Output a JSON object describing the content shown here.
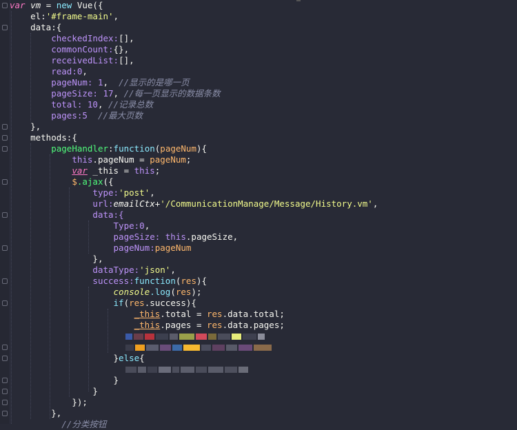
{
  "code": {
    "l1_var": "var",
    "l1_vm": "vm",
    "l1_eq": " = ",
    "l1_new": "new",
    "l1_vue": " Vue({",
    "l2_el": "el:",
    "l2_val": "'#frame-main'",
    "l2_end": ",",
    "l3_data": "data:{",
    "l4_key": "checkedIndex:",
    "l4_val": "[],",
    "l5_key": "commonCount:",
    "l5_val": "{},",
    "l6_key": "receivedList:",
    "l6_val": "[],",
    "l7_key": "read:",
    "l7_num": "0",
    "l7_end": ",",
    "l8_key": "pageNum: ",
    "l8_num": "1",
    "l8_end": ",  ",
    "l8_com": "//显示的是哪一页",
    "l9_key": "pageSize: ",
    "l9_num": "17",
    "l9_end": ", ",
    "l9_com": "//每一页显示的数据条数",
    "l10_key": "total: ",
    "l10_num": "10",
    "l10_end": ", ",
    "l10_com": "//记录总数",
    "l11_key": "pages:",
    "l11_num": "5",
    "l11_sp": "  ",
    "l11_com": "//最大页数",
    "l12": "},",
    "l13": "methods:{",
    "l14_fn": "pageHandler",
    "l14_colon": ":",
    "l14_function": "function",
    "l14_p1": "(",
    "l14_arg": "pageNum",
    "l14_p2": "){",
    "l15_this": "this",
    "l15_prop": ".pageNum",
    "l15_eq": " = ",
    "l15_val": "pageNum",
    "l15_end": ";",
    "l16_var": "var",
    "l16_name": " _this",
    "l16_eq": " = ",
    "l16_this": "this",
    "l16_end": ";",
    "l17_a": "$",
    "l17_b": ".ajax",
    "l17_c": "({",
    "l18_key": "type:",
    "l18_val": "'post'",
    "l18_end": ",",
    "l19_key": "url:",
    "l19_var": "emailCtx",
    "l19_plus": "+",
    "l19_val": "'/CommunicationManage/Message/History.vm'",
    "l19_end": ",",
    "l20": "data:{",
    "l21_key": "Type:",
    "l21_num": "0",
    "l21_end": ",",
    "l22_key": "pageSize: ",
    "l22_this": "this",
    "l22_prop": ".pageSize",
    "l22_end": ",",
    "l23_key": "pageNum:",
    "l23_val": "pageNum",
    "l24": "},",
    "l25_key": "dataType:",
    "l25_val": "'json'",
    "l25_end": ",",
    "l26_key": "success:",
    "l26_function": "function",
    "l26_p1": "(",
    "l26_arg": "res",
    "l26_p2": "){",
    "l27_console": "console",
    "l27_log": ".log",
    "l27_p1": "(",
    "l27_arg": "res",
    "l27_p2": ");",
    "l28_if": "if",
    "l28_p": "(",
    "l28_res": "res",
    "l28_rest": ".success){",
    "l29_this": "_this",
    "l29_prop": ".total",
    "l29_eq": " = ",
    "l29_res": "res",
    "l29_rest": ".data.total;",
    "l30_this": "_this",
    "l30_prop": ".pages",
    "l30_eq": " = ",
    "l30_res": "res",
    "l30_rest": ".data.pages;",
    "l33_a": "}",
    "l33_else": "else",
    "l33_b": "{",
    "l35": "}",
    "l36": "}",
    "l37": "});",
    "l38": "},",
    "l39_com": "//分类按钮"
  },
  "colors": {
    "background": "#282a36",
    "keyword": "#8be9fd",
    "string": "#f1fa8c",
    "number": "#bd93f9",
    "function": "#50fa7b",
    "variable": "#ffb86c",
    "comment": "#8a8ea8",
    "var_keyword": "#ff79c6"
  }
}
